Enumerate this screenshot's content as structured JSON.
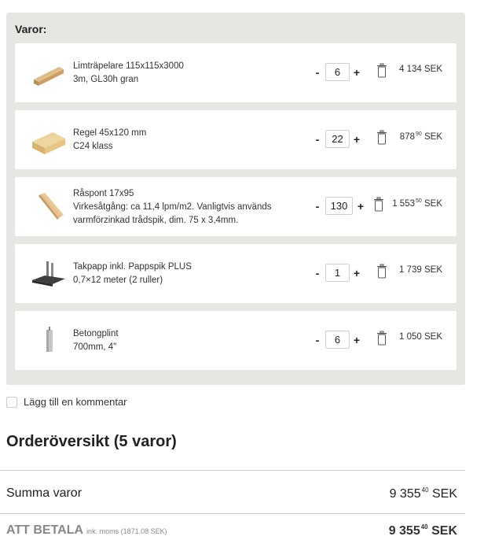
{
  "cart": {
    "title": "Varor:",
    "items": [
      {
        "name": "Limträpelare 115x115x3000",
        "lines": [
          "Limträpelare 115x115x3000",
          "3m, GL30h gran"
        ],
        "quantity": "6",
        "price_main": "4 134 SEK",
        "price_cents": "",
        "price_suffix": "",
        "image": "glulam-post"
      },
      {
        "name": "Regel 45x120 mm",
        "lines": [
          "Regel 45x120 mm",
          "C24 klass"
        ],
        "quantity": "22",
        "price_main": "878",
        "price_cents": "90",
        "price_suffix": "SEK",
        "image": "timber-stud"
      },
      {
        "name": "Råspont 17x95",
        "lines": [
          "Råspont 17x95",
          "Virkesåtgång: ca 11,4 lpm/m2. Vanligtvis används",
          "varmförzinkad trådspik, dim. 75 x 3,4mm."
        ],
        "quantity": "130",
        "price_main": "1 553",
        "price_cents": "50",
        "price_suffix": "SEK",
        "image": "tongue-groove-board"
      },
      {
        "name": "Takpapp inkl. Pappspik PLUS",
        "lines": [
          "Takpapp inkl. Pappspik PLUS",
          "0,7×12 meter (2 ruller)"
        ],
        "quantity": "1",
        "price_main": "1 739 SEK",
        "price_cents": "",
        "price_suffix": "",
        "image": "roofing-felt"
      },
      {
        "name": "Betongplint",
        "lines": [
          "Betongplint",
          "700mm, 4\""
        ],
        "quantity": "6",
        "price_main": "1 050 SEK",
        "price_cents": "",
        "price_suffix": "",
        "image": "concrete-plinth"
      }
    ],
    "minus_label": "-",
    "plus_label": "+",
    "trash_icon": "trash-icon"
  },
  "comment": {
    "label": "Lägg till en kommentar",
    "checked": false
  },
  "order": {
    "title": "Orderöversikt (5 varor)",
    "sum_label": "Summa varor",
    "sum_main": "9 355",
    "sum_cents": "40",
    "sum_suffix": "SEK",
    "pay_label": "ATT BETALA",
    "pay_moms": "ink. moms (1871.08 SEK)",
    "pay_main": "9 355",
    "pay_cents": "40",
    "pay_suffix": "SEK"
  },
  "colors": {
    "panel_bg": "#e8e6e3",
    "card_bg": "#ffffff",
    "text": "#333333",
    "muted": "#888888",
    "divider": "#cfcfcf"
  }
}
